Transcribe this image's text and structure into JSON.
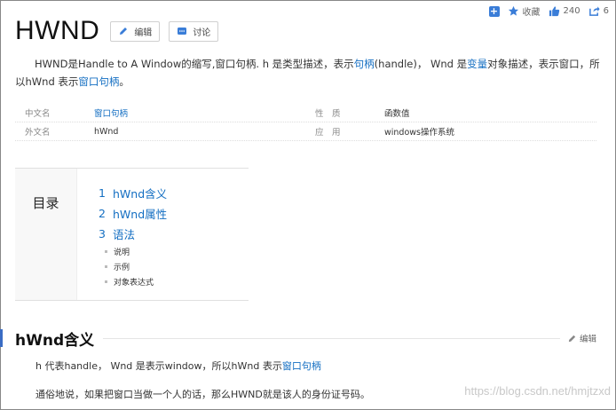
{
  "topbar": {
    "favorite_label": "收藏",
    "like_count": "240",
    "share_count": "6"
  },
  "title": "HWND",
  "buttons": {
    "edit": "编辑",
    "discuss": "讨论"
  },
  "summary": {
    "part1": "HWND是Handle to A Window的缩写,窗口句柄. h 是类型描述，表示",
    "link1": "句柄",
    "part2": "(handle)， Wnd 是",
    "link2": "变量",
    "part3": "对象描述，表示窗口，所以hWnd 表示",
    "link3": "窗口句柄",
    "part4": "。"
  },
  "info": [
    {
      "k1": "中文名",
      "v1": "窗口句柄",
      "k2": "性　质",
      "v2": "函数值"
    },
    {
      "k1": "外文名",
      "v1": "hWnd",
      "k2": "应　用",
      "v2": "windows操作系统"
    }
  ],
  "toc": {
    "title": "目录",
    "items": [
      {
        "num": "1",
        "label": "hWnd含义"
      },
      {
        "num": "2",
        "label": "hWnd属性"
      },
      {
        "num": "3",
        "label": "语法"
      }
    ],
    "subs": [
      "说明",
      "示例",
      "对象表达式"
    ]
  },
  "section": {
    "title": "hWnd含义",
    "edit": "编辑",
    "p1_text": "h 代表handle， Wnd 是表示window，所以hWnd 表示",
    "p1_link": "窗口句柄",
    "p2_text": "通俗地说，如果把窗口当做一个人的话，那么HWND就是该人的身份证号码。"
  },
  "watermark": "https://blog.csdn.net/hmjtzxd",
  "colors": {
    "link": "#136ec2",
    "accent": "#3a7dd8"
  }
}
